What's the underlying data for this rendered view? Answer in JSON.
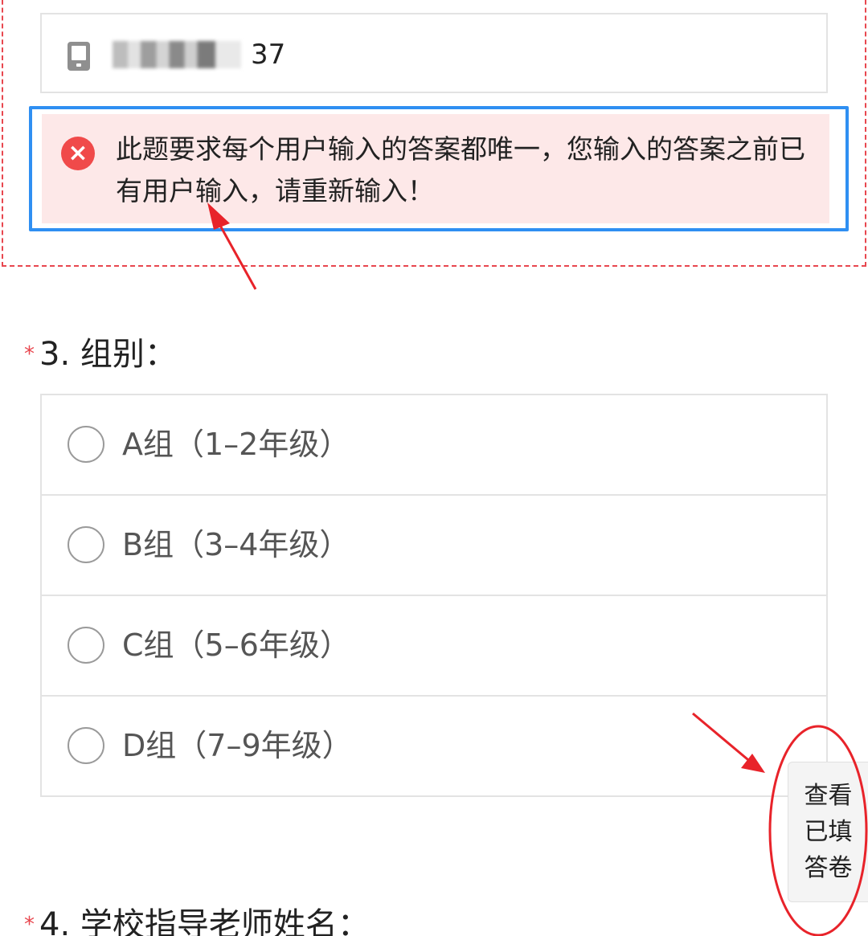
{
  "phone_field": {
    "icon": "phone-icon",
    "value_tail": "37"
  },
  "error": {
    "icon": "error-x-icon",
    "message": "此题要求每个用户输入的答案都唯一，您输入的答案之前已有用户输入，请重新输入！"
  },
  "question3": {
    "required_mark": "*",
    "title": "3. 组别：",
    "options": [
      {
        "label": "A组（1–2年级）"
      },
      {
        "label": "B组（3–4年级）"
      },
      {
        "label": "C组（5–6年级）"
      },
      {
        "label": "D组（7–9年级）"
      }
    ]
  },
  "question4": {
    "required_mark": "*",
    "title": "4. 学校指导老师姓名："
  },
  "side_button": {
    "line1": "查看",
    "line2": "已填",
    "line3": "答卷"
  },
  "colors": {
    "error_background": "#fde8e8",
    "focus_border": "#2f8ff2",
    "required": "#e8474f",
    "annotation": "#e8232a"
  }
}
